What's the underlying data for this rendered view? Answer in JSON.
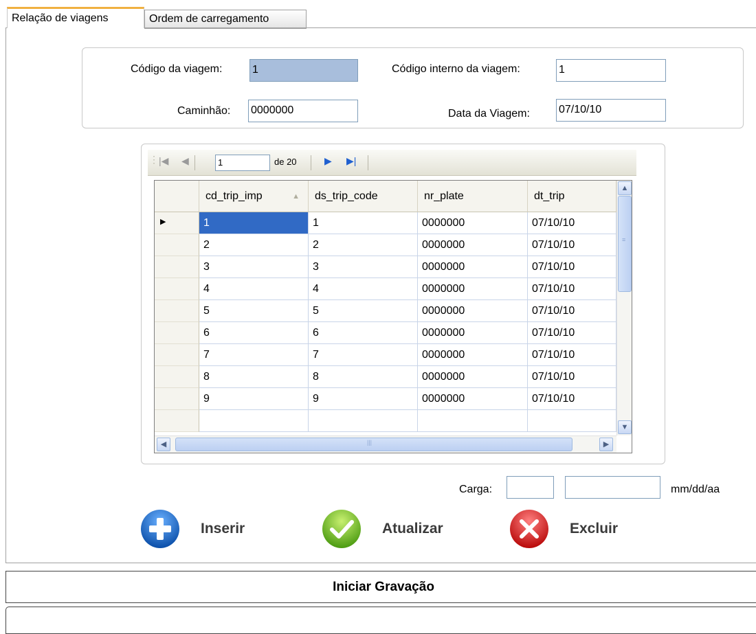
{
  "tabs": [
    {
      "label": "Relação de viagens",
      "active": true
    },
    {
      "label": "Ordem de carregamento",
      "active": false
    }
  ],
  "form": {
    "codigo_viagem_label": "Código da viagem:",
    "codigo_viagem_value": "1",
    "codigo_interno_label": "Código interno da viagem:",
    "codigo_interno_value": "1",
    "caminhao_label": "Caminhão:",
    "caminhao_value": "0000000",
    "data_viagem_label": "Data da Viagem:",
    "data_viagem_value": "07/10/10"
  },
  "navigator": {
    "position": "1",
    "of_label": "de 20"
  },
  "grid": {
    "columns": [
      "cd_trip_imp",
      "ds_trip_code",
      "nr_plate",
      "dt_trip"
    ],
    "rows": [
      [
        "1",
        "1",
        "0000000",
        "07/10/10"
      ],
      [
        "2",
        "2",
        "0000000",
        "07/10/10"
      ],
      [
        "3",
        "3",
        "0000000",
        "07/10/10"
      ],
      [
        "4",
        "4",
        "0000000",
        "07/10/10"
      ],
      [
        "5",
        "5",
        "0000000",
        "07/10/10"
      ],
      [
        "6",
        "6",
        "0000000",
        "07/10/10"
      ],
      [
        "7",
        "7",
        "0000000",
        "07/10/10"
      ],
      [
        "8",
        "8",
        "0000000",
        "07/10/10"
      ],
      [
        "9",
        "9",
        "0000000",
        "07/10/10"
      ]
    ],
    "selected_row": 0
  },
  "carga": {
    "label": "Carga:",
    "value1": "",
    "value2": "",
    "format_hint": "mm/dd/aa"
  },
  "actions": {
    "insert_label": "Inserir",
    "update_label": "Atualizar",
    "delete_label": "Excluir"
  },
  "start_recording_label": "Iniciar Gravação",
  "colors": {
    "tab_accent": "#f0b040",
    "readonly_input": "#a8bedc",
    "selected_cell": "#316ac5",
    "insert_icon": "#1a66c8",
    "update_icon": "#6cb81c",
    "delete_icon": "#d81818"
  }
}
